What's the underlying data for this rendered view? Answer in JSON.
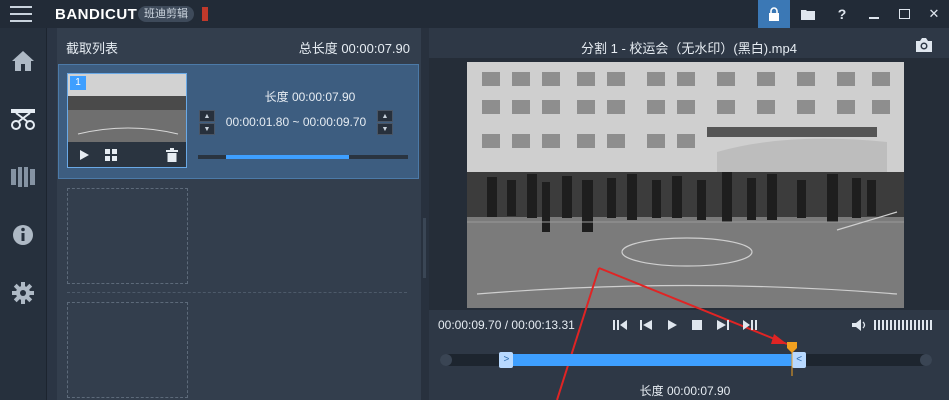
{
  "app": {
    "logo_text": "BANDICUT",
    "badge_text": "班迪剪辑",
    "accent_color": "#3e9fff"
  },
  "window_controls": {
    "lock_icon": "lock-icon",
    "folder_icon": "folder-icon",
    "help_label": "?",
    "minimize_icon": "minimize-icon",
    "maximize_icon": "maximize-icon",
    "close_label": "✕"
  },
  "sidebar": {
    "items": [
      {
        "icon": "menu-icon"
      },
      {
        "icon": "home-icon"
      },
      {
        "icon": "cut-icon"
      },
      {
        "icon": "film-icon"
      },
      {
        "icon": "info-icon"
      },
      {
        "icon": "gear-icon"
      }
    ]
  },
  "clip_list": {
    "title": "截取列表",
    "total_length": "总长度 00:00:07.90",
    "clips": [
      {
        "index": "1",
        "length_label": "长度 00:00:07.90",
        "range": "00:00:01.80 ~ 00:00:09.70",
        "progress": 0.68
      }
    ]
  },
  "preview": {
    "file_title": "分割 1 - 校运会（无水印）(黑白).mp4",
    "time_readout": "00:00:09.70 / 00:00:13.31",
    "segment_length": "长度 00:00:07.90",
    "segment_start": 0.135,
    "segment_end": 0.73
  }
}
